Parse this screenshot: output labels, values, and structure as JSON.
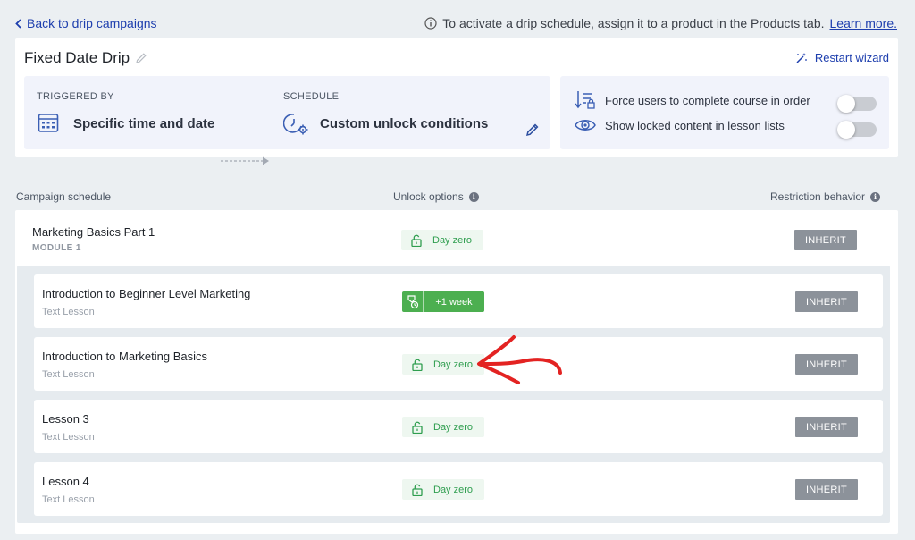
{
  "nav": {
    "back_label": "Back to drip campaigns"
  },
  "notice": {
    "text": "To activate a drip schedule, assign it to a product in the Products tab.",
    "link": "Learn more."
  },
  "campaign": {
    "title": "Fixed Date Drip",
    "restart_label": "Restart wizard",
    "triggered_by_caption": "TRIGGERED BY",
    "triggered_by_value": "Specific time and date",
    "schedule_caption": "SCHEDULE",
    "schedule_value": "Custom unlock conditions"
  },
  "settings": {
    "force_order_label": "Force users to complete course in order",
    "force_order_on": false,
    "show_locked_label": "Show locked content in lesson lists",
    "show_locked_on": false
  },
  "columns": {
    "schedule": "Campaign schedule",
    "unlock": "Unlock options",
    "restriction": "Restriction behavior"
  },
  "module": {
    "title": "Marketing Basics Part 1",
    "subtitle": "MODULE 1",
    "unlock": "Day zero",
    "restriction": "INHERIT"
  },
  "lessons": [
    {
      "title": "Introduction to Beginner Level Marketing",
      "type": "Text Lesson",
      "unlock": "+1 week",
      "unlock_style": "week",
      "restriction": "INHERIT"
    },
    {
      "title": "Introduction to Marketing Basics",
      "type": "Text Lesson",
      "unlock": "Day zero",
      "unlock_style": "day",
      "restriction": "INHERIT"
    },
    {
      "title": "Lesson 3",
      "type": "Text Lesson",
      "unlock": "Day zero",
      "unlock_style": "day",
      "restriction": "INHERIT"
    },
    {
      "title": "Lesson 4",
      "type": "Text Lesson",
      "unlock": "Day zero",
      "unlock_style": "day",
      "restriction": "INHERIT"
    }
  ],
  "colors": {
    "link": "#1e3fae",
    "unlock_green": "#2f9e4f",
    "unlock_green_bg": "#eef7f0",
    "inherit_gray": "#8c929a",
    "annotation_red": "#e32322"
  }
}
